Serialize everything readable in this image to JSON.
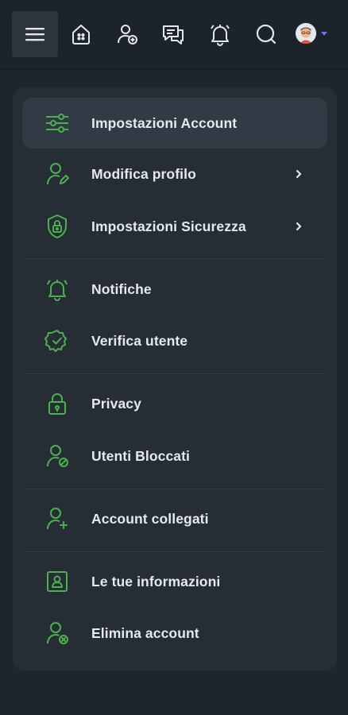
{
  "topbar": {
    "icons": [
      "menu-icon",
      "home-icon",
      "add-user-icon",
      "messages-icon",
      "bell-icon",
      "search-icon"
    ],
    "avatar": "avatar",
    "accent": "#4caf50"
  },
  "menu": {
    "items": [
      {
        "label": "Impostazioni Account",
        "icon": "sliders-icon",
        "active": true
      },
      {
        "label": "Modifica profilo",
        "icon": "user-edit-icon",
        "chevron": true
      },
      {
        "label": "Impostazioni Sicurezza",
        "icon": "shield-lock-icon",
        "chevron": true
      },
      {
        "label": "Notifiche",
        "icon": "bell-icon"
      },
      {
        "label": "Verifica utente",
        "icon": "verified-badge-icon"
      },
      {
        "label": "Privacy",
        "icon": "lock-icon"
      },
      {
        "label": "Utenti Bloccati",
        "icon": "user-blocked-icon"
      },
      {
        "label": "Account collegati",
        "icon": "user-add-icon"
      },
      {
        "label": "Le tue informazioni",
        "icon": "id-card-icon"
      },
      {
        "label": "Elimina account",
        "icon": "user-remove-icon"
      }
    ]
  },
  "colors": {
    "background": "#1f252c",
    "panel": "#262d34",
    "active": "#323b45",
    "icon_green": "#4caf50",
    "text": "#e6e9ec"
  }
}
